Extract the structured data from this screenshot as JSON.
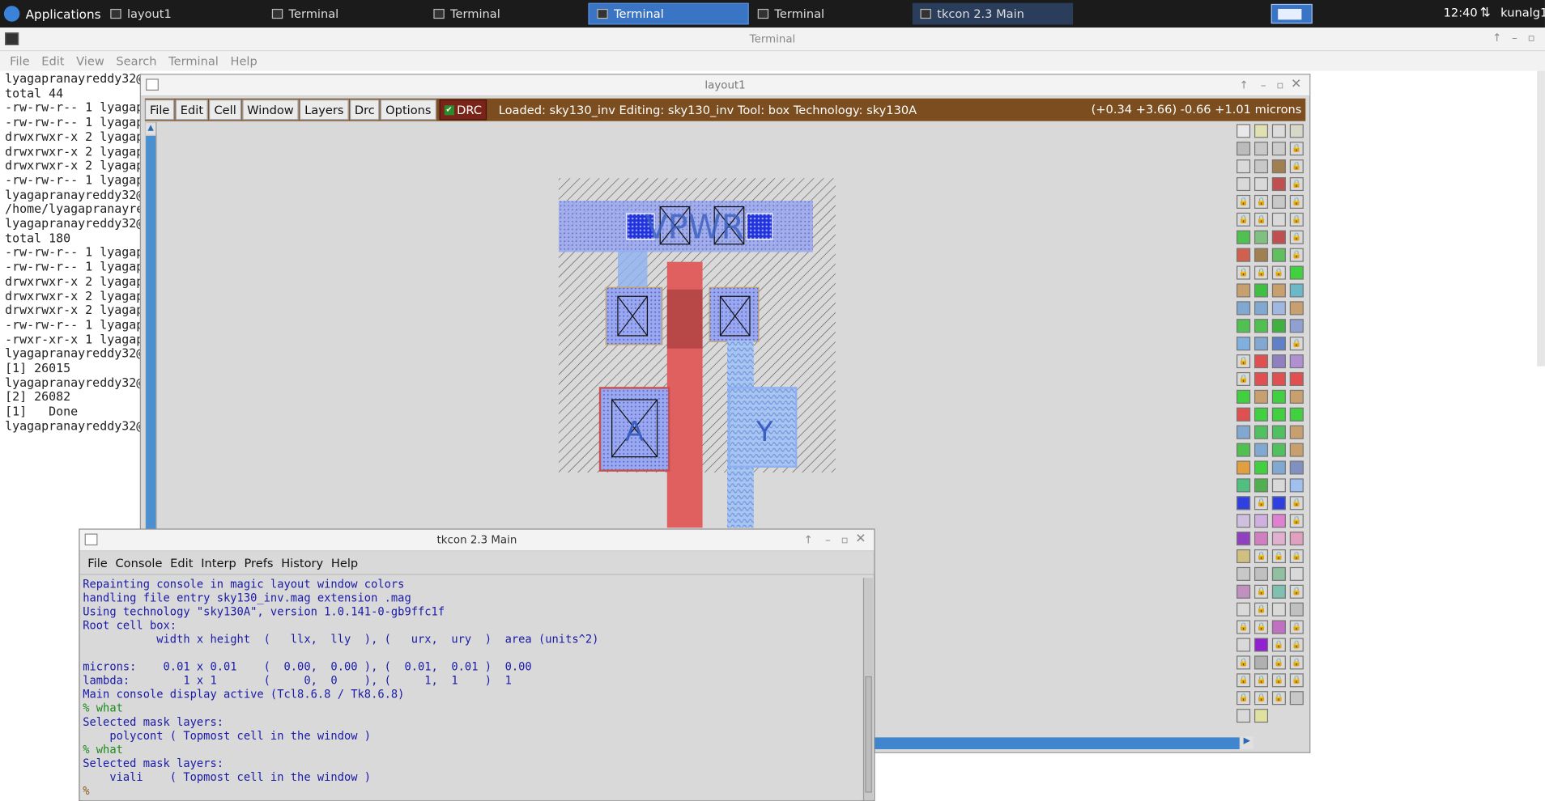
{
  "taskbar": {
    "applications": "Applications",
    "tasks": [
      "layout1",
      "Terminal",
      "Terminal",
      "Terminal",
      "Terminal",
      "tkcon 2.3 Main"
    ],
    "clock": "12:40",
    "user": "kunalg1"
  },
  "terminal": {
    "title": "Terminal",
    "menu": [
      "File",
      "Edit",
      "View",
      "Search",
      "Terminal",
      "Help"
    ],
    "lines": [
      "lyagapranayreddy32@",
      "total 44",
      "-rw-rw-r-- 1 lyagap",
      "-rw-rw-r-- 1 lyagap",
      "drwxrwxr-x 2 lyagap",
      "drwxrwxr-x 2 lyagap",
      "drwxrwxr-x 2 lyagap",
      "-rw-rw-r-- 1 lyagap",
      "lyagapranayreddy32@",
      "/home/lyagapranayre",
      "lyagapranayreddy32@",
      "total 180",
      "-rw-rw-r-- 1 lyagap",
      "-rw-rw-r-- 1 lyagap",
      "drwxrwxr-x 2 lyagap",
      "drwxrwxr-x 2 lyagap",
      "drwxrwxr-x 2 lyagap",
      "-rw-rw-r-- 1 lyagap",
      "-rwxr-xr-x 1 lyagap",
      "lyagapranayreddy32@",
      "[1] 26015",
      "lyagapranayreddy32@",
      "[2] 26082",
      "[1]   Done",
      "lyagapranayreddy32@"
    ]
  },
  "layout": {
    "title": "layout1",
    "menu": [
      "File",
      "Edit",
      "Cell",
      "Window",
      "Layers",
      "Drc",
      "Options"
    ],
    "drc_label": "DRC",
    "status": "Loaded: sky130_inv Editing: sky130_inv Tool: box  Technology: sky130A",
    "coords": "(+0.34 +3.66) -0.66 +1.01 microns",
    "labels": {
      "vpwr": "VPWR",
      "a": "A",
      "y": "Y"
    },
    "colors": {
      "toolbar": "#7b4d1f",
      "poly": "#e06060",
      "metal": "#9aa8f0",
      "diff": "#c8a060"
    }
  },
  "tkcon": {
    "title": "tkcon 2.3 Main",
    "menu": [
      "File",
      "Console",
      "Edit",
      "Interp",
      "Prefs",
      "History",
      "Help"
    ],
    "lines": [
      "Repainting console in magic layout window colors",
      "handling file entry sky130_inv.mag extension .mag",
      "Using technology \"sky130A\", version 1.0.141-0-gb9ffc1f",
      "Root cell box:",
      "           width x height  (   llx,  lly  ), (   urx,  ury  )  area (units^2)",
      "",
      "microns:    0.01 x 0.01    (  0.00,  0.00 ), (  0.01,  0.01 )  0.00",
      "lambda:        1 x 1       (     0,  0    ), (     1,  1    )  1",
      "Main console display active (Tcl8.6.8 / Tk8.6.8)",
      "% what",
      "Selected mask layers:",
      "    polycont ( Topmost cell in the window )",
      "% what",
      "Selected mask layers:",
      "    viali    ( Topmost cell in the window )",
      "%"
    ]
  }
}
